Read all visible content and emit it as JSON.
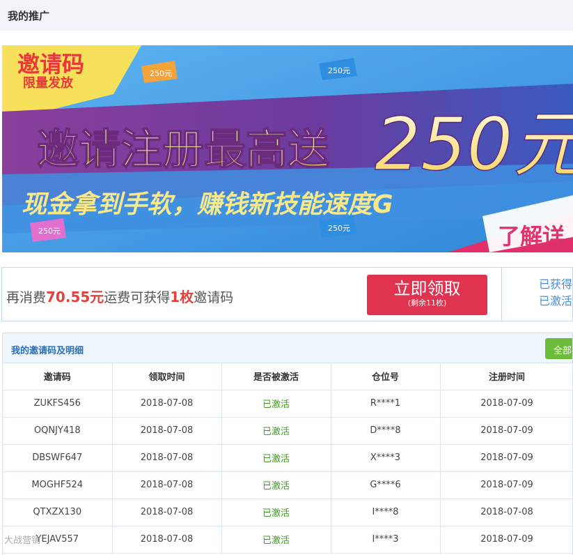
{
  "page": {
    "title": "我的推广"
  },
  "banner": {
    "badge_line1": "邀请码",
    "badge_line2": "限量发放",
    "headline": "邀请注册最高送",
    "amount": "250元/",
    "subline": "现金拿到手软，赚钱新技能速度G",
    "cta": "了解详",
    "ticket_label": "250元"
  },
  "claim": {
    "prefix": "再消费",
    "amount": "70.55元",
    "middle": "运费可获得",
    "count": "1枚",
    "suffix": "邀请码",
    "button_label": "立即领取",
    "button_sub": "(剩余11枚)",
    "stat_obtained": "已获得",
    "stat_activated": "已激活"
  },
  "invites": {
    "title": "我的邀请码及明细",
    "filter_label": "全部",
    "columns": [
      "邀请码",
      "领取时间",
      "是否被激活",
      "仓位号",
      "注册时间"
    ],
    "rows": [
      [
        "ZUKFS456",
        "2018-07-08",
        "已激活",
        "R****1",
        "2018-07-09"
      ],
      [
        "OQNJY418",
        "2018-07-08",
        "已激活",
        "D****8",
        "2018-07-09"
      ],
      [
        "DBSWF647",
        "2018-07-08",
        "已激活",
        "X****3",
        "2018-07-09"
      ],
      [
        "MOGHF524",
        "2018-07-08",
        "已激活",
        "G****6",
        "2018-07-09"
      ],
      [
        "QTXZX130",
        "2018-07-08",
        "已激活",
        "I****8",
        "2018-07-08"
      ],
      [
        "YEJAV557",
        "2018-07-08",
        "已激活",
        "I****3",
        "2018-07-09"
      ]
    ]
  },
  "watermark": "大战营销",
  "colors": {
    "accent_red": "#e0334f",
    "link_blue": "#4a8fd9",
    "success_green": "#3d9a1e",
    "filter_green": "#6cbc3c"
  }
}
